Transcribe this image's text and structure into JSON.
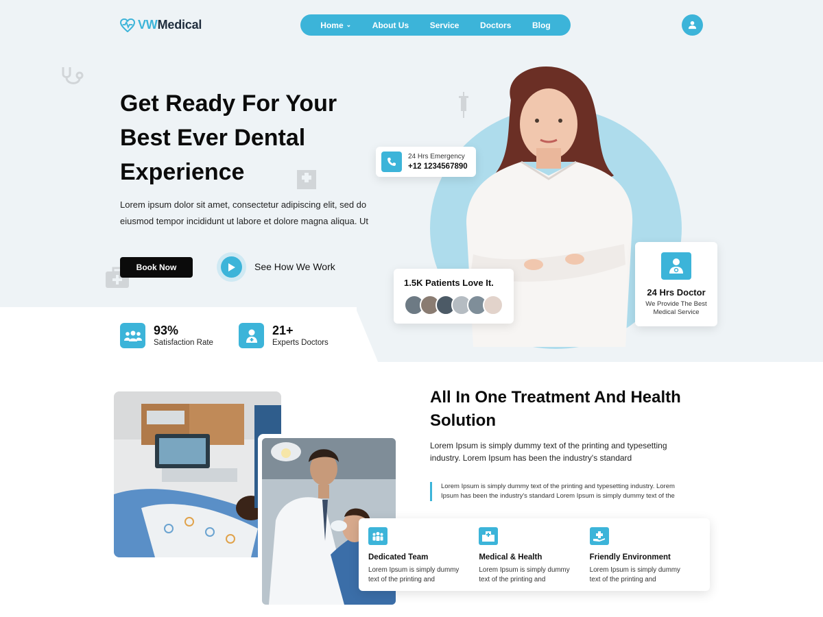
{
  "brand": {
    "prefix": "VW",
    "name": "Medical",
    "accent": "#3cb4d9"
  },
  "nav": {
    "items": [
      {
        "label": "Home",
        "has_dropdown": true
      },
      {
        "label": "About Us"
      },
      {
        "label": "Service"
      },
      {
        "label": "Doctors"
      },
      {
        "label": "Blog"
      }
    ]
  },
  "hero": {
    "title_lines": [
      "Get Ready For Your",
      "Best Ever Dental",
      "Experience"
    ],
    "description_lines": [
      "Lorem ipsum dolor sit amet, consectetur adipiscing elit, sed do",
      "eiusmod tempor incididunt ut labore et dolore magna aliqua. Ut"
    ],
    "book_label": "Book Now",
    "video_label": "See How We Work"
  },
  "stats": [
    {
      "value": "93%",
      "label": "Satisfaction Rate",
      "icon": "group-icon"
    },
    {
      "value": "21+",
      "label": "Experts Doctors",
      "icon": "doctor-badge-icon"
    }
  ],
  "emergency": {
    "label": "24 Hrs Emergency",
    "phone": "+12 1234567890"
  },
  "patients": {
    "title": "1.5K Patients Love It."
  },
  "doctor_card": {
    "title": "24 Hrs Doctor",
    "subtitle_lines": [
      "We Provide The Best",
      "Medical Service"
    ]
  },
  "section": {
    "title_lines": [
      "All In One Treatment And Health",
      "Solution"
    ],
    "description_lines": [
      "Lorem Ipsum is simply dummy text of the printing and typesetting",
      "industry. Lorem Ipsum has been the industry's standard"
    ],
    "quote_lines": [
      "Lorem Ipsum is simply dummy text of the printing and typesetting industry. Lorem",
      "Ipsum has been the industry's standard Lorem Ipsum is simply dummy text of the"
    ]
  },
  "features": [
    {
      "title": "Dedicated Team",
      "icon": "team-icon",
      "desc_lines": [
        "Lorem Ipsum is simply dummy",
        "text of the printing and"
      ]
    },
    {
      "title": "Medical & Health",
      "icon": "hospital-icon",
      "desc_lines": [
        "Lorem Ipsum is simply dummy",
        "text of the printing and"
      ]
    },
    {
      "title": "Friendly Environment",
      "icon": "care-hand-icon",
      "desc_lines": [
        "Lorem Ipsum is simply dummy",
        "text of the printing and"
      ]
    }
  ]
}
